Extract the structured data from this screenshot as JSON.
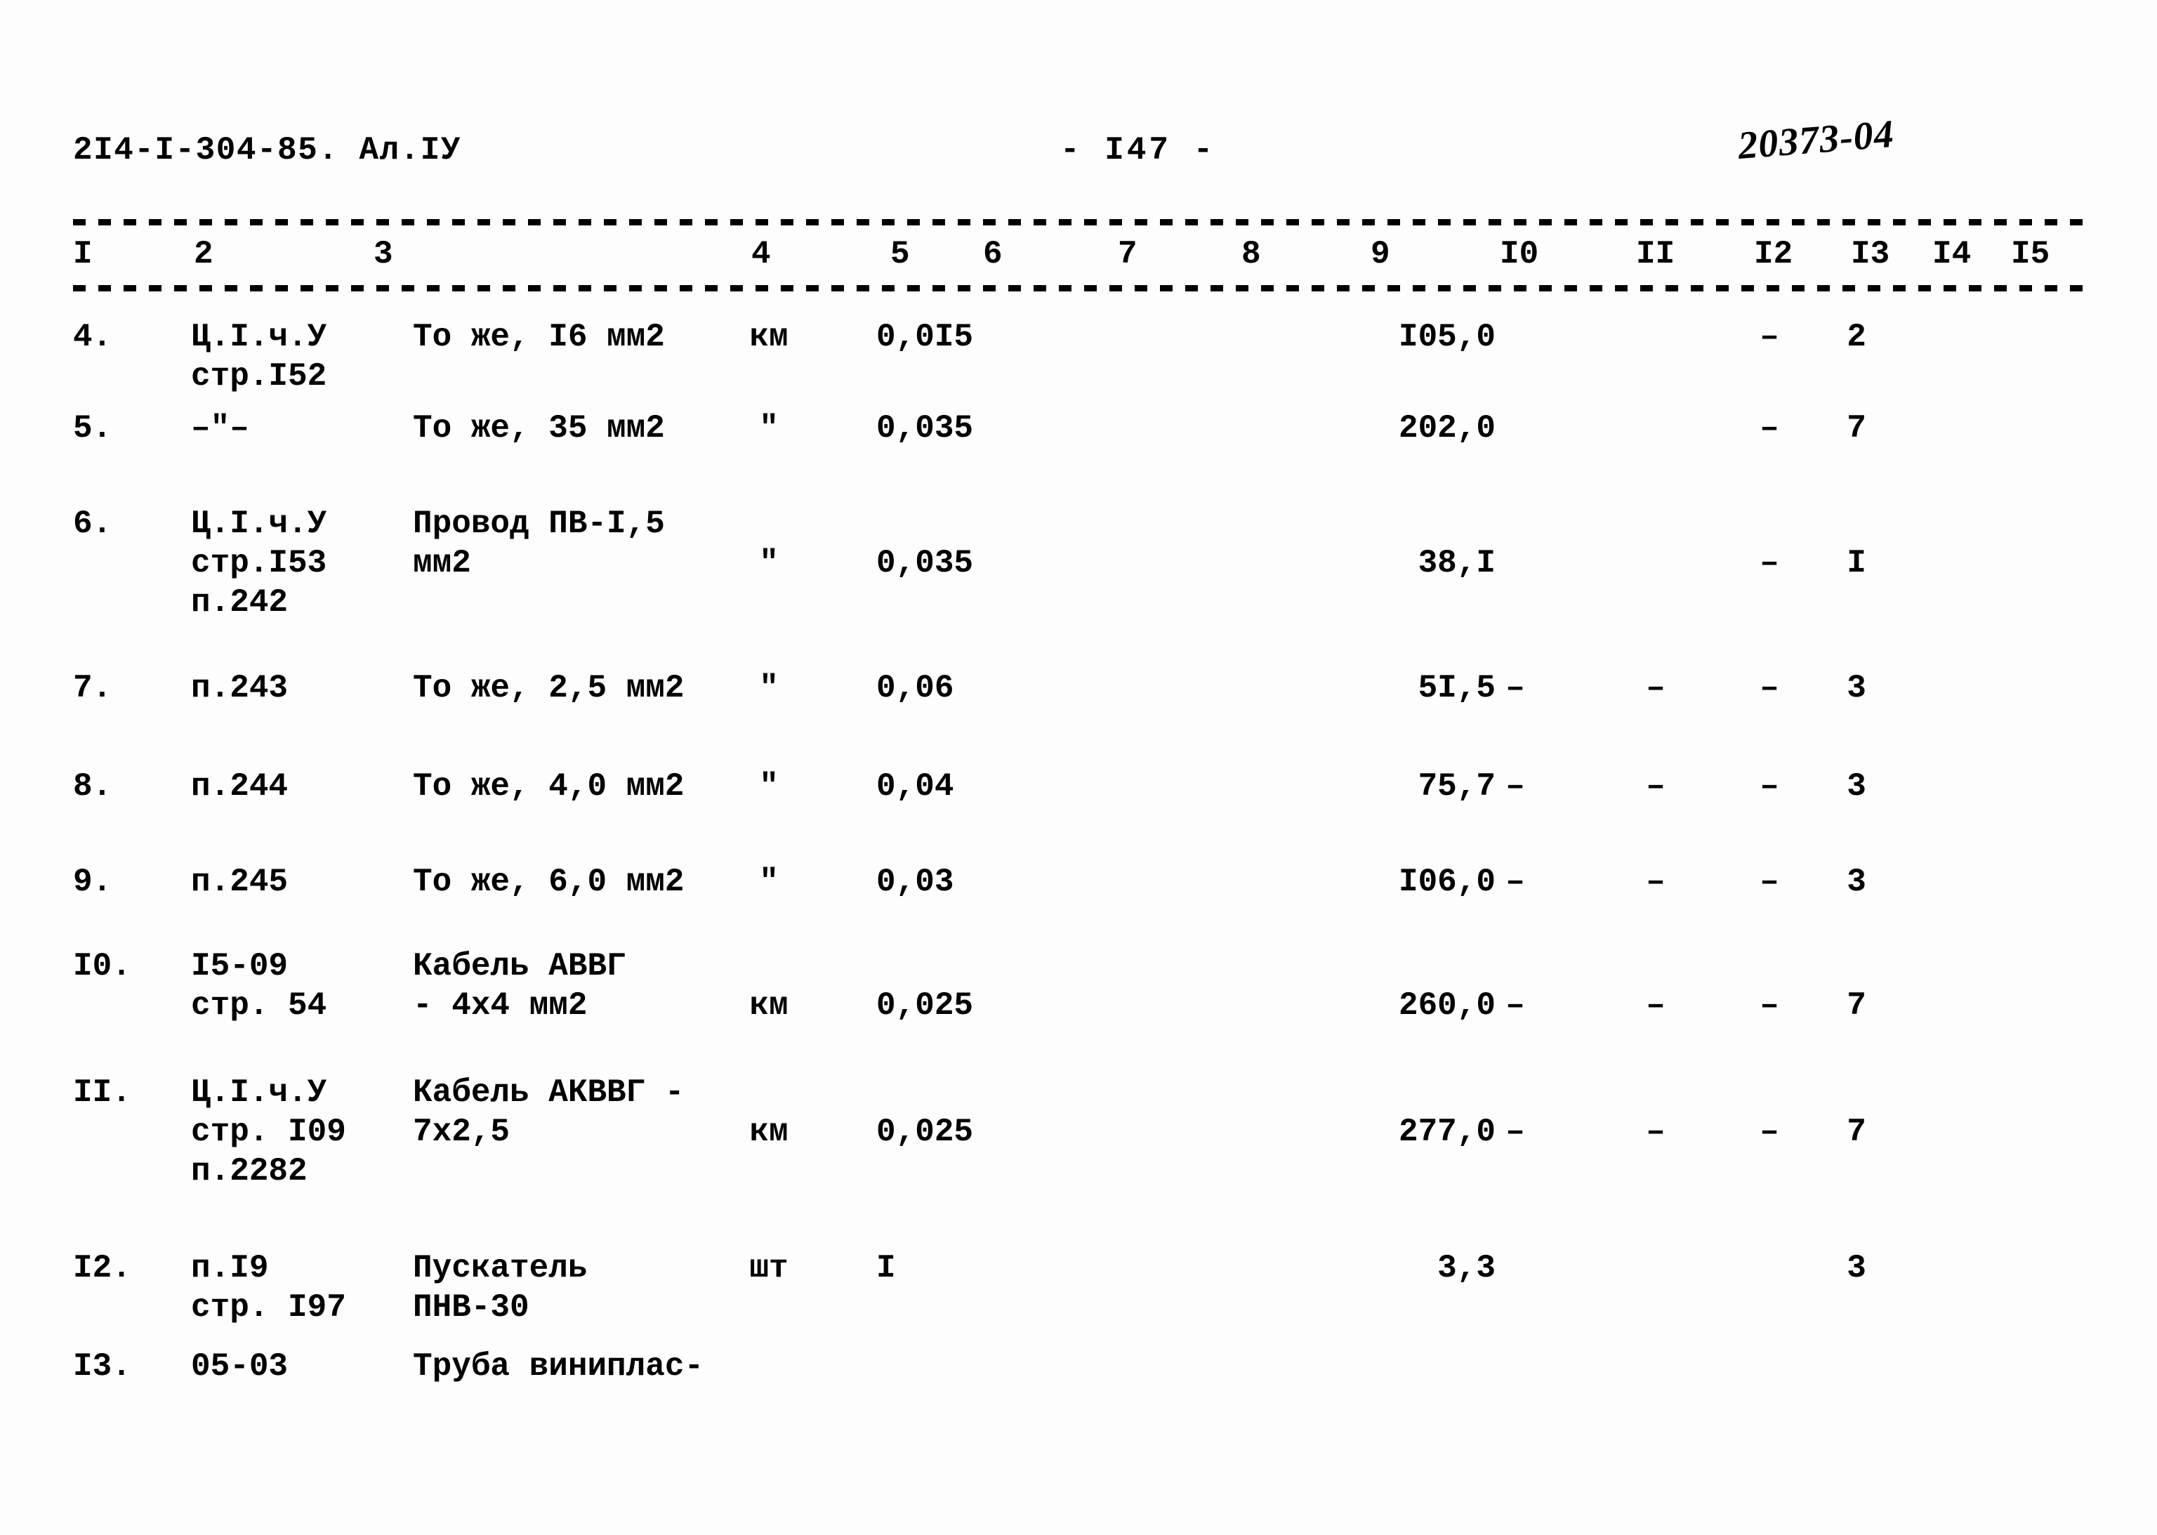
{
  "header": {
    "doc_code": "2I4-I-304-85.  Ал.IУ",
    "page_marker": "-  I47  -",
    "stamp": "20373-04"
  },
  "table": {
    "column_headers": [
      "I",
      "2",
      "3",
      "4",
      "5",
      "6",
      "7",
      "8",
      "9",
      "I0",
      "II",
      "I2",
      "I3",
      "I4",
      "I5"
    ],
    "rows": [
      {
        "num": "4.",
        "ref": "Ц.I.ч.У\nстр.I52",
        "name": "То же, I6 мм2",
        "unit": "км",
        "qty": "0,0I5",
        "val9": "I05,0",
        "c10": "",
        "c11": "",
        "c12": "–",
        "c13": "2"
      },
      {
        "num": "5.",
        "ref": "–\"–",
        "name": "То же, 35 мм2",
        "unit": "\"",
        "qty": "0,035",
        "val9": "202,0",
        "c10": "",
        "c11": "",
        "c12": "–",
        "c13": "7"
      },
      {
        "num": "6.",
        "ref": "Ц.I.ч.У\nстр.I53\nп.242",
        "name": "Провод ПВ-I,5\nмм2",
        "unit": "\"",
        "qty": "0,035",
        "val9": "38,I",
        "c10": "",
        "c11": "",
        "c12": "–",
        "c13": "I"
      },
      {
        "num": "7.",
        "ref": "п.243",
        "name": "То же, 2,5 мм2",
        "unit": "\"",
        "qty": "0,06",
        "val9": "5I,5",
        "c10": "–",
        "c11": "–",
        "c12": "–",
        "c13": "3"
      },
      {
        "num": "8.",
        "ref": "п.244",
        "name": "То же, 4,0 мм2",
        "unit": "\"",
        "qty": "0,04",
        "val9": "75,7",
        "c10": "–",
        "c11": "–",
        "c12": "–",
        "c13": "3"
      },
      {
        "num": "9.",
        "ref": "п.245",
        "name": "То же, 6,0 мм2",
        "unit": "\"",
        "qty": "0,03",
        "val9": "I06,0",
        "c10": "–",
        "c11": "–",
        "c12": "–",
        "c13": "3"
      },
      {
        "num": "I0.",
        "ref": "I5-09\nстр. 54",
        "name": "Кабель АВВГ\n- 4х4 мм2",
        "unit": "км",
        "qty": "0,025",
        "val9": "260,0",
        "c10": "–",
        "c11": "–",
        "c12": "–",
        "c13": "7"
      },
      {
        "num": "II.",
        "ref": "Ц.I.ч.У\nстр. I09\nп.2282",
        "name": "Кабель АКВВГ -\n7х2,5",
        "unit": "км",
        "qty": "0,025",
        "val9": "277,0",
        "c10": "–",
        "c11": "–",
        "c12": "–",
        "c13": "7"
      },
      {
        "num": "I2.",
        "ref": "п.I9\nстр. I97",
        "name": "Пускатель\nПНВ-30",
        "unit": "шт",
        "qty": "I",
        "val9": "3,3",
        "c10": "",
        "c11": "",
        "c12": "",
        "c13": "3"
      },
      {
        "num": "I3.",
        "ref": "05-03",
        "name": "Труба виниплас-",
        "unit": "",
        "qty": "",
        "val9": "",
        "c10": "",
        "c11": "",
        "c12": "",
        "c13": ""
      }
    ]
  }
}
